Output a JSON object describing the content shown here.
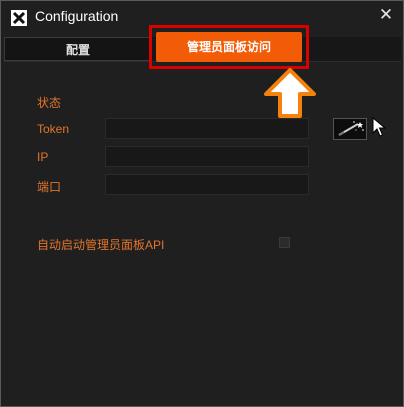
{
  "window": {
    "title": "Configuration",
    "close_symbol": "✕"
  },
  "tabs": [
    {
      "label": "配置"
    },
    {
      "label": "管理员面板访问",
      "active": true
    }
  ],
  "form": {
    "status_label": "状态",
    "token_label": "Token",
    "token_value": "",
    "ip_label": "IP",
    "ip_value": "",
    "port_label": "端口",
    "port_value": "",
    "autostart_label": "自动启动管理员面板API",
    "autostart_checked": false
  },
  "icons": {
    "app": "app-logo-icon",
    "close": "close-icon",
    "generate": "magic-wand-icon",
    "pointer": "mouse-cursor-icon",
    "annotation": "up-arrow-icon"
  },
  "colors": {
    "accent": "#f25c07",
    "label": "#e2742c",
    "highlight_border": "#d90000",
    "background": "#1f1f1f"
  }
}
